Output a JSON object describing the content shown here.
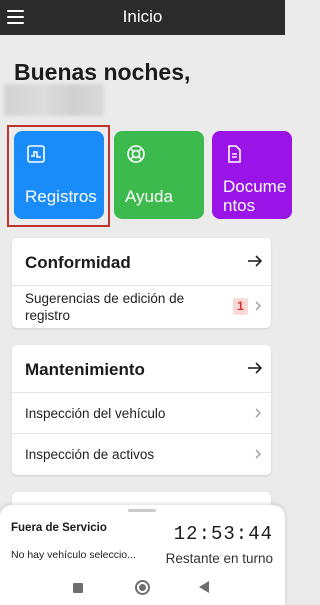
{
  "appbar": {
    "title": "Inicio",
    "menu_icon": "hamburger-menu-icon"
  },
  "greeting": "Buenas noches,",
  "tiles": [
    {
      "label": "Registros",
      "icon": "logbook-chart-icon",
      "color": "#1a8cfa"
    },
    {
      "label": "Ayuda",
      "icon": "lifebuoy-icon",
      "color": "#3dba4e"
    },
    {
      "label": "Documentos",
      "label_line1": "Docume",
      "label_line2": "ntos",
      "icon": "document-icon",
      "color": "#9a14e8"
    }
  ],
  "conformidad": {
    "title": "Conformidad",
    "rows": [
      {
        "label_line1": "Sugerencias de edición de",
        "label_line2": "registro",
        "badge": "1"
      }
    ]
  },
  "mantenimiento": {
    "title": "Mantenimiento",
    "rows": [
      {
        "label": "Inspección del vehículo"
      },
      {
        "label": "Inspección de activos"
      }
    ]
  },
  "bottom": {
    "duty_status": "Fuera de Servicio",
    "vehicle": "No hay vehículo seleccio...",
    "timer": "12:53:44",
    "timer_label": "Restante en turno"
  },
  "colors": {
    "highlight": "#c0342e",
    "badge_bg": "#fbd9d7",
    "badge_text": "#d9312d",
    "appbar": "#2b2b2b"
  }
}
